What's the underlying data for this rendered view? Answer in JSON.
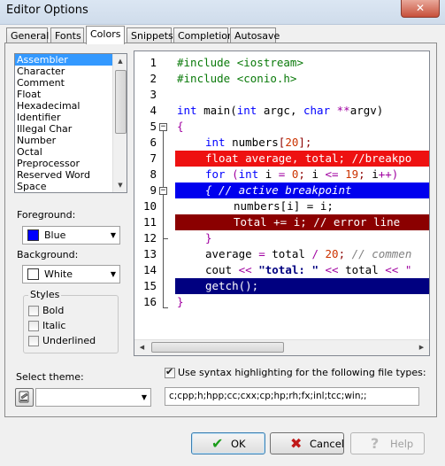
{
  "window": {
    "title": "Editor Options",
    "close_glyph": "✕"
  },
  "tabs": [
    "General",
    "Fonts",
    "Colors",
    "Snippets",
    "Completion",
    "Autosave"
  ],
  "languages": [
    "Assembler",
    "Character",
    "Comment",
    "Float",
    "Hexadecimal",
    "Identifier",
    "Illegal Char",
    "Number",
    "Octal",
    "Preprocessor",
    "Reserved Word",
    "Space"
  ],
  "foreground": {
    "label": "Foreground:",
    "value": "Blue",
    "color": "#0000ff"
  },
  "background": {
    "label": "Background:",
    "value": "White",
    "color": "#ffffff"
  },
  "styles": {
    "legend": "Styles",
    "bold": "Bold",
    "italic": "Italic",
    "underlined": "Underlined"
  },
  "theme": {
    "label": "Select theme:",
    "value": ""
  },
  "syntax": {
    "label": "Use syntax highlighting for the following file types:",
    "checked": true,
    "file_types": "c;cpp;h;hpp;cc;cxx;cp;hp;rh;fx;inl;tcc;win;;"
  },
  "code": {
    "line_numbers": [
      "1",
      "2",
      "3",
      "4",
      "5",
      "6",
      "7",
      "8",
      "9",
      "10",
      "11",
      "12",
      "13",
      "14",
      "15",
      "16"
    ],
    "l1_pre": "#include <iostream>",
    "l2_pre": "#include <conio.h>",
    "l4_kw1": "int",
    "l4_t1": " main(",
    "l4_kw2": "int",
    "l4_t2": " argc, ",
    "l4_kw3": "char",
    "l4_t3": " ",
    "l4_op": "**",
    "l4_t4": "argv)",
    "l5_brace": "{",
    "l6_kw": "int",
    "l6_t1": " numbers",
    "l6_s1": "[",
    "l6_num": "20",
    "l6_s2": "]",
    "l6_s3": ";",
    "l7_text": "float average, total; //breakpo",
    "l8_kw1": "for",
    "l8_t1": " (",
    "l8_kw2": "int",
    "l8_t2": " i ",
    "l8_op1": "=",
    "l8_t3": " ",
    "l8_num1": "0",
    "l8_s1": ";",
    "l8_t4": " i ",
    "l8_op2": "<=",
    "l8_t5": " ",
    "l8_num2": "19",
    "l8_s2": ";",
    "l8_t6": " i",
    "l8_op3": "++)",
    "l9_text": "{ // active breakpoint",
    "l10_text": "numbers[i] = i;",
    "l11_text": "Total += i; // error line",
    "l12_brace": "}",
    "l13_t1": "average ",
    "l13_op1": "=",
    "l13_t2": " total ",
    "l13_op2": "/",
    "l13_t3": " ",
    "l13_num": "20",
    "l13_s": ";",
    "l13_t4": " ",
    "l13_com": "// commen",
    "l14_t1": "cout ",
    "l14_op1": "<<",
    "l14_t2": " ",
    "l14_str": "\"total: \"",
    "l14_t3": " ",
    "l14_op2": "<<",
    "l14_t4": " total ",
    "l14_op3": "<< \"",
    "l15_text": "getch();",
    "l16_brace": "}"
  },
  "buttons": {
    "ok": "OK",
    "cancel": "Cancel",
    "help": "Help"
  },
  "colors": {
    "selection": "#3399ff",
    "error_line": "#8b0000",
    "breakpoint": "#ee1111",
    "active_breakpoint": "#0000ee",
    "exec_line": "#000080"
  }
}
